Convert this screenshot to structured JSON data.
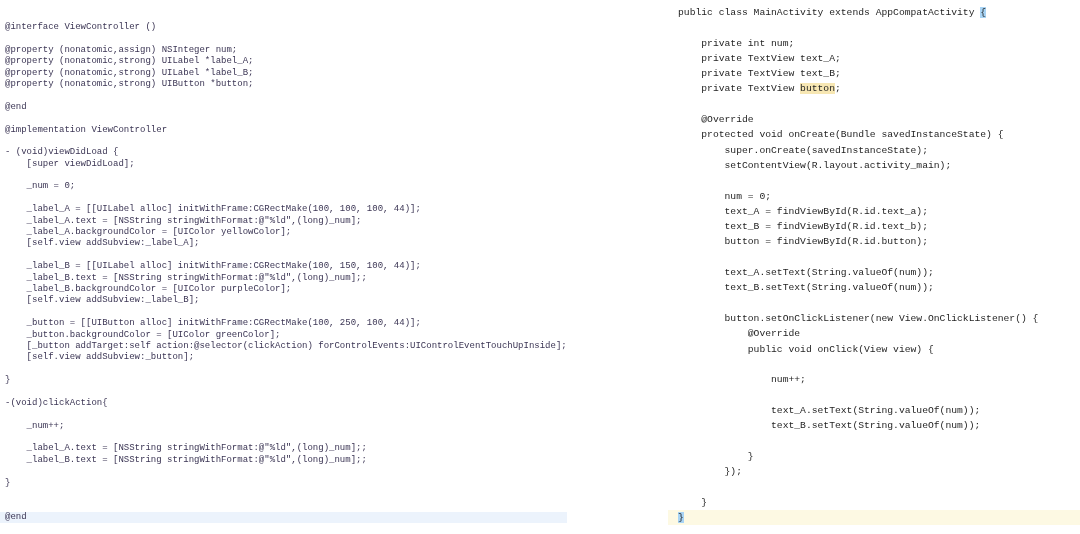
{
  "panels": [
    {
      "blocks": [
        {
          "lines": [
            {
              "text": "@interface ViewController ()"
            }
          ]
        },
        {
          "lines": [
            {
              "text": "@property (nonatomic,assign) NSInteger num;"
            },
            {
              "text": "@property (nonatomic,strong) UILabel *label_A;"
            },
            {
              "text": "@property (nonatomic,strong) UILabel *label_B;"
            },
            {
              "text": "@property (nonatomic,strong) UIButton *button;"
            }
          ]
        },
        {
          "lines": [
            {
              "text": "@end"
            }
          ]
        },
        {
          "lines": [
            {
              "text": "@implementation ViewController"
            }
          ]
        },
        {
          "lines": [
            {
              "text": "- (void)viewDidLoad {"
            },
            {
              "text": "    [super viewDidLoad];"
            }
          ]
        },
        {
          "lines": [
            {
              "text": "    _num = 0;"
            }
          ]
        },
        {
          "lines": [
            {
              "text": "    _label_A = [[UILabel alloc] initWithFrame:CGRectMake(100, 100, 100, 44)];"
            },
            {
              "text": "    _label_A.text = [NSString stringWithFormat:@\"%ld\",(long)_num];"
            },
            {
              "text": "    _label_A.backgroundColor = [UIColor yellowColor];"
            },
            {
              "text": "    [self.view addSubview:_label_A];"
            }
          ]
        },
        {
          "lines": [
            {
              "text": "    _label_B = [[UILabel alloc] initWithFrame:CGRectMake(100, 150, 100, 44)];"
            },
            {
              "text": "    _label_B.text = [NSString stringWithFormat:@\"%ld\",(long)_num];;"
            },
            {
              "text": "    _label_B.backgroundColor = [UIColor purpleColor];"
            },
            {
              "text": "    [self.view addSubview:_label_B];"
            }
          ]
        },
        {
          "lines": [
            {
              "text": "    _button = [[UIButton alloc] initWithFrame:CGRectMake(100, 250, 100, 44)];"
            },
            {
              "text": "    _button.backgroundColor = [UIColor greenColor];"
            },
            {
              "text": "    [_button addTarget:self action:@selector(clickAction) forControlEvents:UIControlEventTouchUpInside];"
            },
            {
              "text": "    [self.view addSubview:_button];"
            }
          ]
        },
        {
          "lines": [
            {
              "text": "}"
            }
          ]
        },
        {
          "lines": [
            {
              "text": "-(void)clickAction{"
            }
          ]
        },
        {
          "lines": [
            {
              "text": "    _num++;"
            }
          ]
        },
        {
          "lines": [
            {
              "text": "    _label_A.text = [NSString stringWithFormat:@\"%ld\",(long)_num];;"
            },
            {
              "text": "    _label_B.text = [NSString stringWithFormat:@\"%ld\",(long)_num];;"
            }
          ]
        },
        {
          "lines": [
            {
              "text": "}"
            }
          ]
        },
        {
          "lines": [
            {
              "text": "@end",
              "current": true
            }
          ]
        }
      ]
    },
    {
      "blocks": [
        {
          "lines": [
            {
              "parts": [
                {
                  "text": "public class MainActivity extends AppCompatActivity "
                },
                {
                  "text": "{",
                  "color": "#a8d4f5"
                }
              ]
            }
          ]
        },
        {
          "lines": [
            {
              "text": "    private int num;"
            },
            {
              "text": "    private TextView text_A;"
            },
            {
              "text": "    private TextView text_B;"
            },
            {
              "parts": [
                {
                  "text": "    private TextView "
                },
                {
                  "text": "button",
                  "color": "#f7e7b3"
                },
                {
                  "text": ";"
                }
              ]
            }
          ]
        },
        {
          "lines": [
            {
              "text": "    @Override"
            },
            {
              "text": "    protected void onCreate(Bundle savedInstanceState) {"
            },
            {
              "text": "        super.onCreate(savedInstanceState);"
            },
            {
              "text": "        setContentView(R.layout.activity_main);"
            }
          ]
        },
        {
          "lines": [
            {
              "text": "        num = 0;"
            },
            {
              "text": "        text_A = findViewById(R.id.text_a);"
            },
            {
              "text": "        text_B = findViewById(R.id.text_b);"
            },
            {
              "text": "        button = findViewById(R.id.button);"
            }
          ]
        },
        {
          "lines": [
            {
              "text": "        text_A.setText(String.valueOf(num));"
            },
            {
              "text": "        text_B.setText(String.valueOf(num));"
            }
          ]
        },
        {
          "lines": [
            {
              "text": "        button.setOnClickListener(new View.OnClickListener() {"
            },
            {
              "text": "            @Override"
            },
            {
              "text": "            public void onClick(View view) {"
            }
          ]
        },
        {
          "lines": [
            {
              "text": "                num++;"
            }
          ]
        },
        {
          "lines": [
            {
              "text": "                text_A.setText(String.valueOf(num));"
            },
            {
              "text": "                text_B.setText(String.valueOf(num));"
            }
          ]
        },
        {
          "lines": [
            {
              "text": "            }"
            },
            {
              "text": "        });"
            }
          ]
        },
        {
          "lines": [
            {
              "text": "    }"
            },
            {
              "parts": [
                {
                  "text": "}",
                  "color": "#a8d4f5"
                }
              ],
              "current": true
            }
          ]
        }
      ]
    }
  ]
}
